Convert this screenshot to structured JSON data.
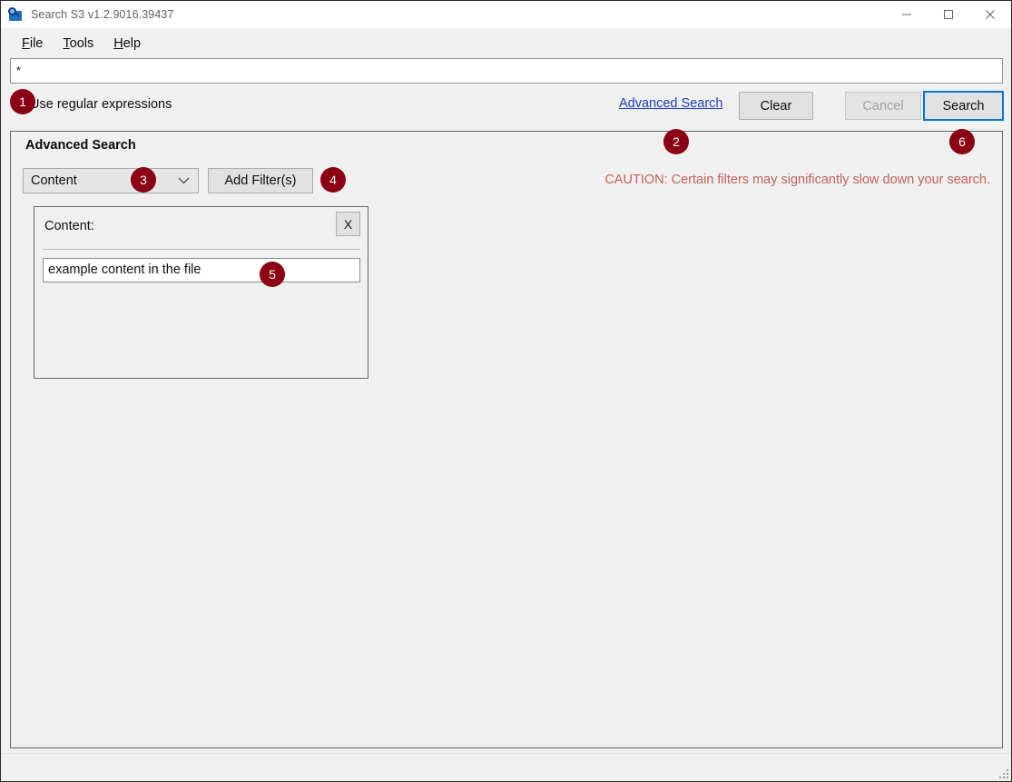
{
  "window": {
    "title": "Search S3 v1.2.9016.39437",
    "app_icon": "magnifier-icon",
    "controls": {
      "minimize": "minimize-icon",
      "maximize": "maximize-icon",
      "close": "close-icon"
    }
  },
  "menubar": {
    "items": [
      {
        "accesskey": "F",
        "rest": "ile"
      },
      {
        "accesskey": "T",
        "rest": "ools"
      },
      {
        "accesskey": "H",
        "rest": "elp"
      }
    ]
  },
  "search": {
    "query_value": "*",
    "regex_checkbox_label": "Use regular expressions",
    "regex_checked": false,
    "advanced_search_link": "Advanced Search",
    "clear_label": "Clear",
    "cancel_label": "Cancel",
    "cancel_disabled": true,
    "search_label": "Search",
    "search_focused": true
  },
  "advanced": {
    "panel_title": "Advanced Search",
    "filter_type_selected": "Content",
    "filter_type_options": [
      "Content"
    ],
    "add_filter_label": "Add Filter(s)",
    "caution_text": "CAUTION: Certain filters may significantly slow down your search.",
    "caution_color": "#c4615c",
    "filters": [
      {
        "title": "Content:",
        "remove_label": "X",
        "value": "example content in the file"
      }
    ]
  },
  "annotations": {
    "badge_color": "#8b0012",
    "markers": [
      {
        "number": "1",
        "target": "use-regular-expressions-checkbox"
      },
      {
        "number": "2",
        "target": "advanced-search-panel"
      },
      {
        "number": "3",
        "target": "filter-type-select"
      },
      {
        "number": "4",
        "target": "add-filters-button"
      },
      {
        "number": "5",
        "target": "filter-value-input"
      },
      {
        "number": "6",
        "target": "search-button"
      }
    ]
  },
  "statusbar": {
    "resize_grip": "resize-grip-icon"
  },
  "theme": {
    "accent_blue": "#0078d7",
    "link_blue": "#1a3fbf",
    "window_bg": "#f0f0f0",
    "button_bg": "#e1e1e1"
  }
}
